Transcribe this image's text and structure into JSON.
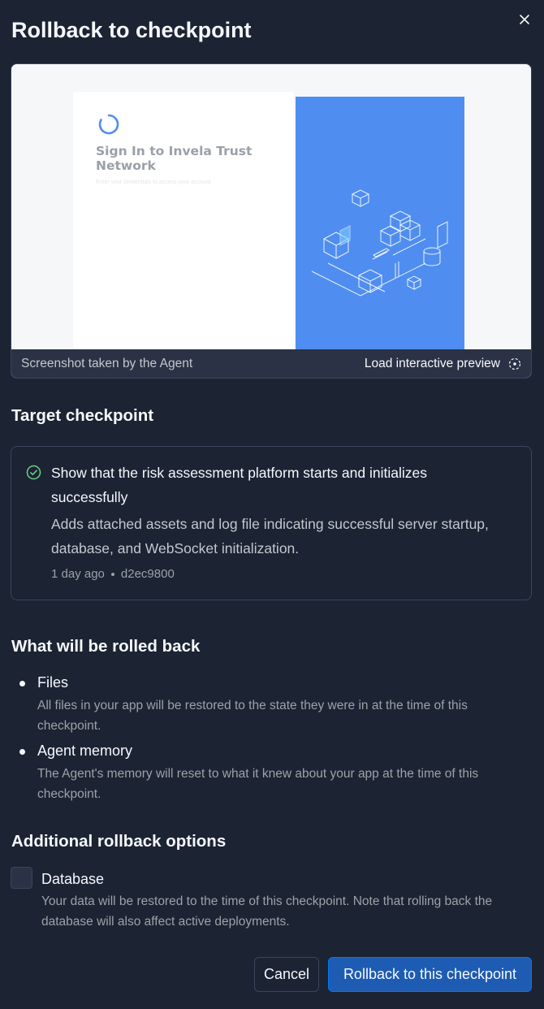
{
  "dialog": {
    "title": "Rollback to checkpoint",
    "close_icon": "close-icon"
  },
  "preview": {
    "screenshot": {
      "title": "Sign In to Invela Trust Network",
      "subtitle": "Enter your credentials to access your account"
    },
    "caption": "Screenshot taken by the Agent",
    "load_label": "Load interactive preview",
    "load_icon": "preview-loading-icon"
  },
  "target": {
    "heading": "Target checkpoint",
    "title": "Show that the risk assessment platform starts and initializes successfully",
    "description": "Adds attached assets and log file indicating successful server startup, database, and WebSocket initialization.",
    "time": "1 day ago",
    "commit": "d2ec9800",
    "status_icon": "check-circle-icon"
  },
  "rollback": {
    "heading": "What will be rolled back",
    "items": [
      {
        "label": "Files",
        "description": "All files in your app will be restored to the state they were in at the time of this checkpoint."
      },
      {
        "label": "Agent memory",
        "description": "The Agent's memory will reset to what it knew about your app at the time of this checkpoint."
      }
    ]
  },
  "options": {
    "heading": "Additional rollback options",
    "database": {
      "label": "Database",
      "checked": false,
      "description": "Your data will be restored to the time of this checkpoint. Note that rolling back the database will also affect active deployments."
    }
  },
  "footer": {
    "cancel_label": "Cancel",
    "confirm_label": "Rollback to this checkpoint"
  },
  "colors": {
    "background": "#1c2333",
    "border": "#3c445c",
    "primary": "#1e5bb3",
    "success": "#6bd08a",
    "preview_panel": "#4f8ef0"
  }
}
